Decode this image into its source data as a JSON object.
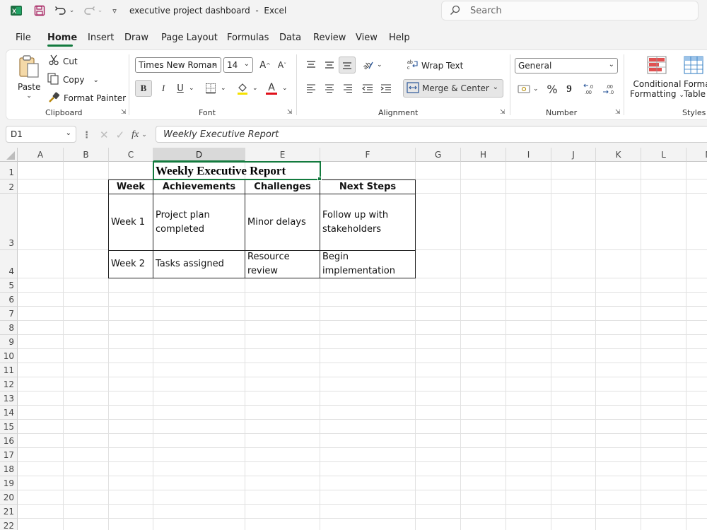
{
  "app": {
    "doc_title": "executive project dashboard",
    "title_separator": "-",
    "app_name": "Excel",
    "search_placeholder": "Search"
  },
  "menu": {
    "tabs": [
      "File",
      "Home",
      "Insert",
      "Draw",
      "Page Layout",
      "Formulas",
      "Data",
      "Review",
      "View",
      "Help"
    ],
    "active_tab": "Home"
  },
  "ribbon": {
    "clipboard": {
      "paste": "Paste",
      "cut": "Cut",
      "copy": "Copy",
      "format_painter": "Format Painter",
      "label": "Clipboard"
    },
    "font": {
      "family": "Times New Roman",
      "size": "14",
      "bold": "B",
      "italic": "I",
      "underline": "U",
      "font_color_glyph": "A",
      "label": "Font"
    },
    "alignment": {
      "wrap_text": "Wrap Text",
      "merge_center": "Merge & Center",
      "label": "Alignment"
    },
    "number": {
      "format": "General",
      "percent": "%",
      "comma": "9",
      "label": "Number"
    },
    "styles": {
      "conditional_line1": "Conditional",
      "conditional_line2": "Formatting",
      "format_table_line1": "Format as",
      "format_table_line2": "Table",
      "label": "Styles"
    }
  },
  "formula_bar": {
    "cell_ref": "D1",
    "fx": "fx",
    "content": "Weekly Executive Report"
  },
  "sheet": {
    "columns": [
      "A",
      "B",
      "C",
      "D",
      "E",
      "F",
      "G",
      "H",
      "I",
      "J",
      "K",
      "L",
      "M"
    ],
    "selected_column": "D",
    "rows": [
      "1",
      "2",
      "3",
      "4",
      "5",
      "6",
      "7",
      "8",
      "9",
      "10",
      "11",
      "12",
      "13",
      "14",
      "15",
      "16",
      "17",
      "18",
      "19",
      "20",
      "21",
      "22"
    ],
    "title": "Weekly Executive Report",
    "table": {
      "headers": [
        "Week",
        "Achievements",
        "Challenges",
        "Next Steps"
      ],
      "rows": [
        {
          "week": "Week 1",
          "achievements": [
            "Project plan",
            "completed"
          ],
          "challenges": [
            "Minor delays"
          ],
          "next_steps": [
            "Follow up with",
            "stakeholders"
          ]
        },
        {
          "week": "Week 2",
          "achievements": [
            "Tasks assigned"
          ],
          "challenges": [
            "Resource",
            "review"
          ],
          "next_steps": [
            "Begin",
            "implementation"
          ]
        }
      ]
    }
  },
  "colors": {
    "accent": "#137a3e",
    "excel_green": "#1d6f42",
    "font_color_bar": "#e0101a",
    "highlight_bar": "#f5e100"
  }
}
